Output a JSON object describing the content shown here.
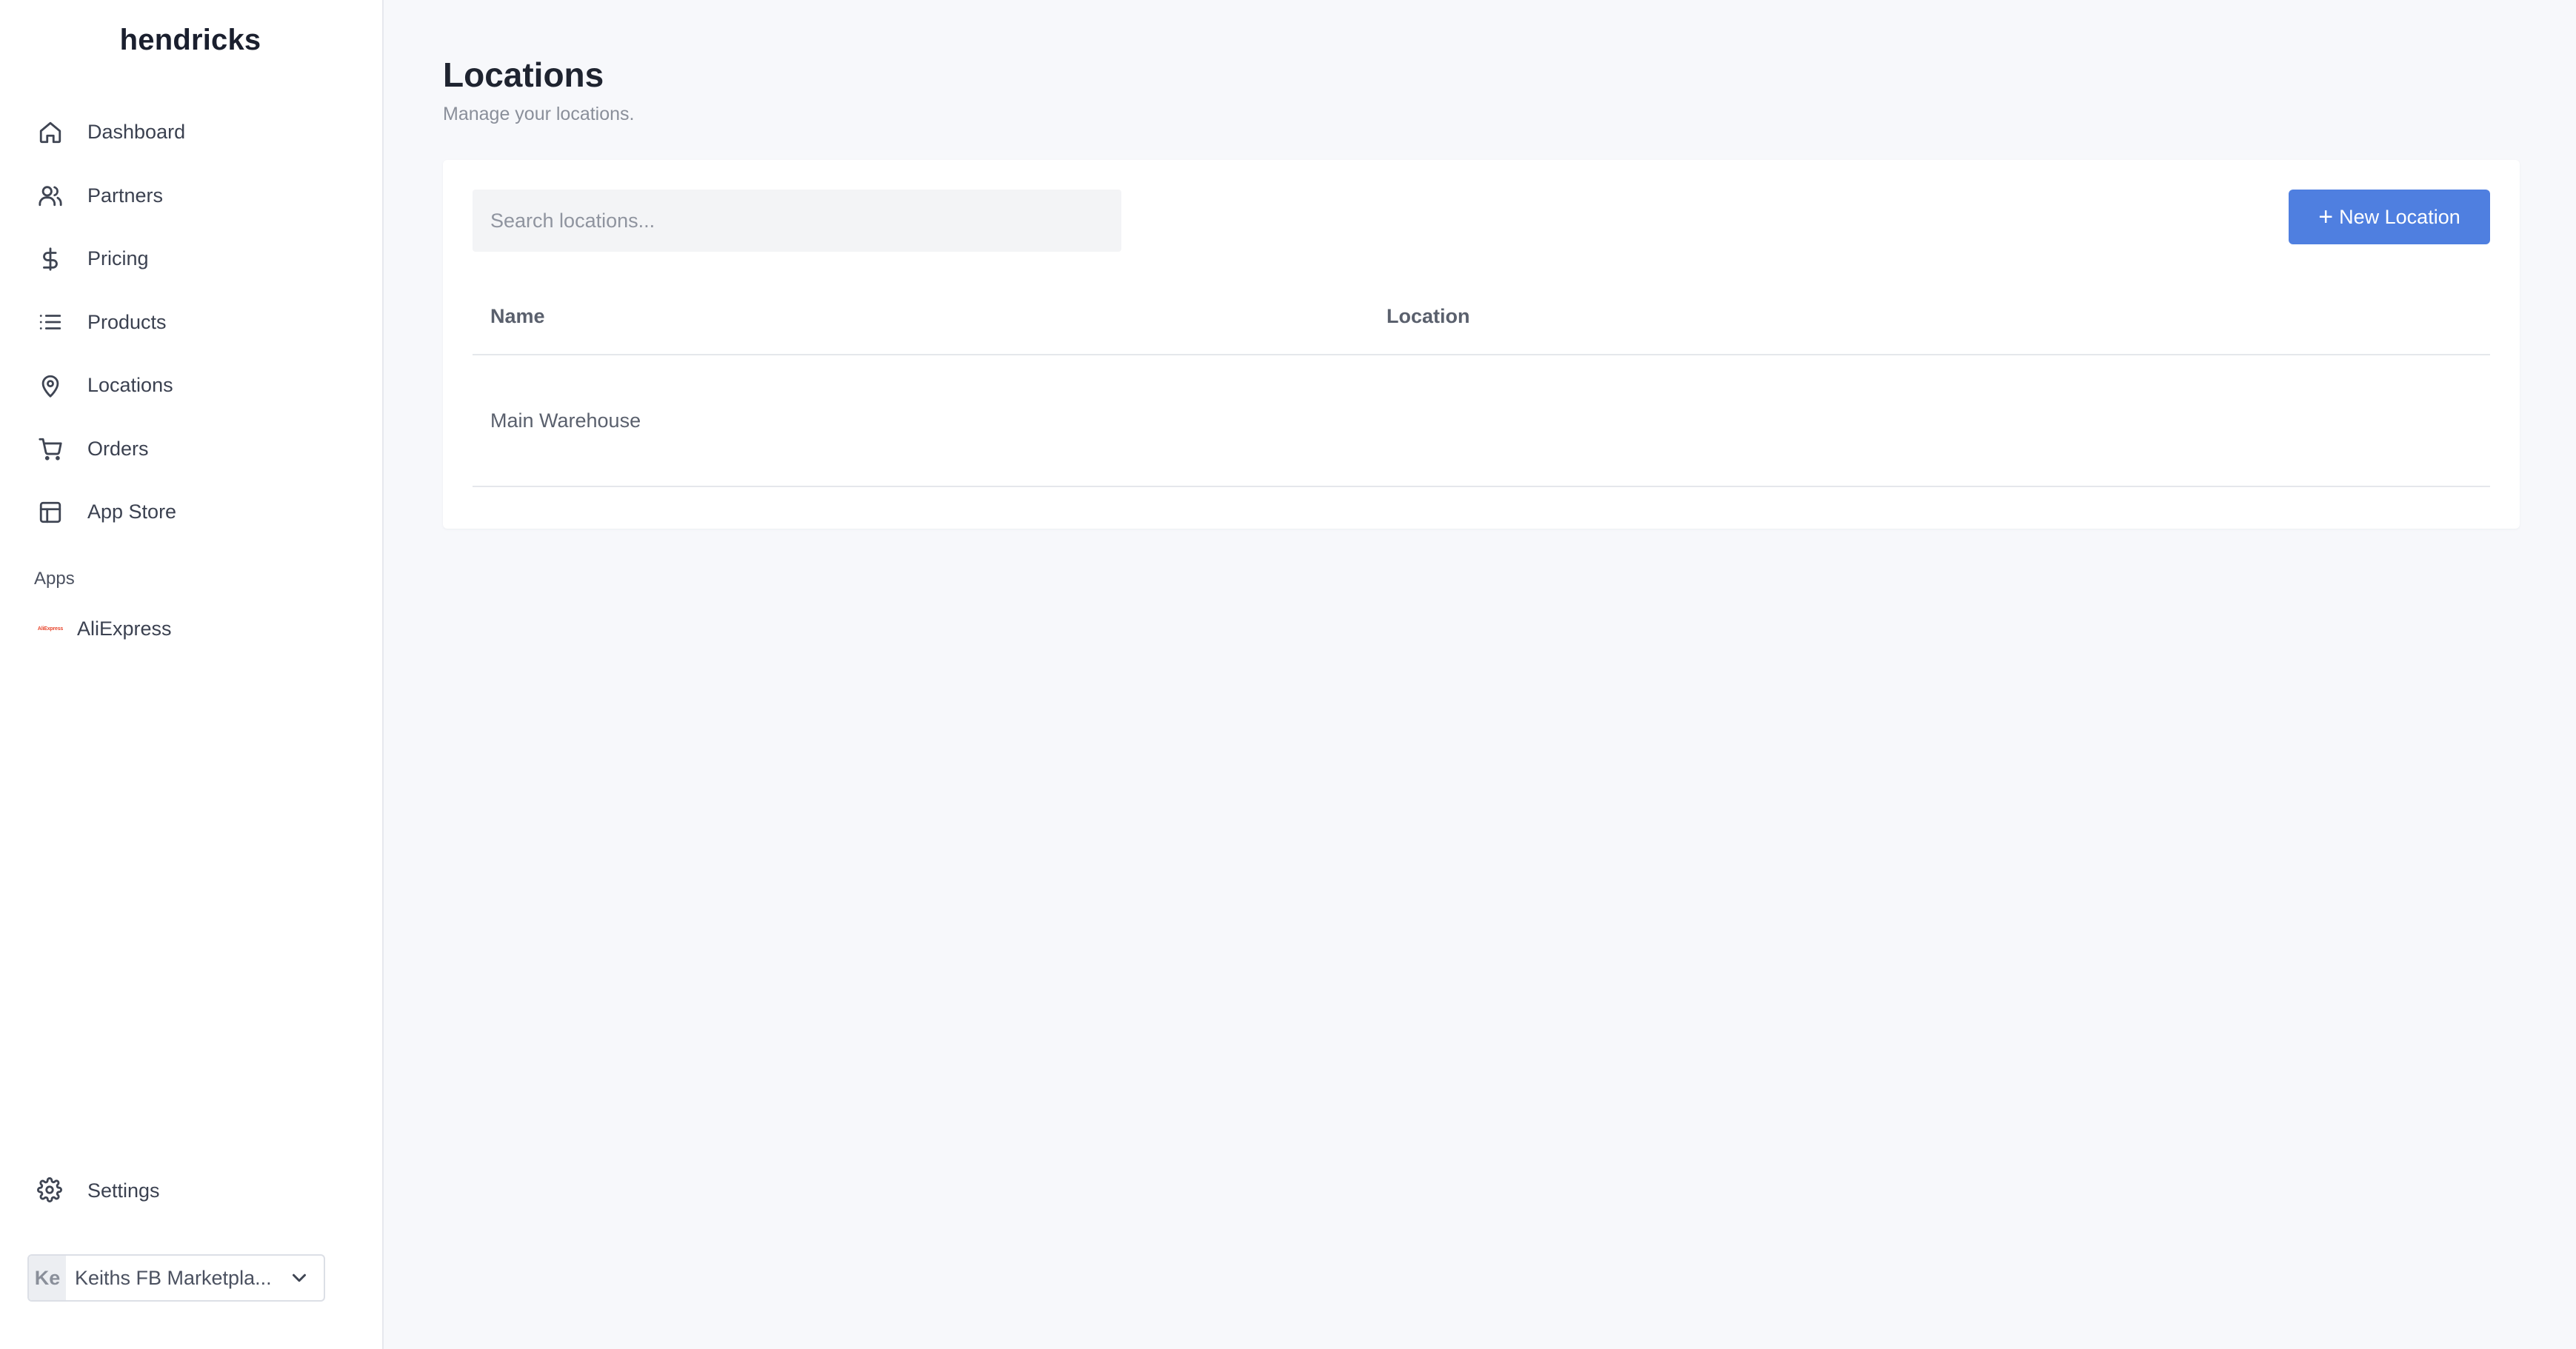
{
  "sidebar": {
    "brand": "hendricks",
    "nav": [
      {
        "label": "Dashboard",
        "icon": "home-icon"
      },
      {
        "label": "Partners",
        "icon": "users-icon"
      },
      {
        "label": "Pricing",
        "icon": "dollar-icon"
      },
      {
        "label": "Products",
        "icon": "list-icon"
      },
      {
        "label": "Locations",
        "icon": "map-pin-icon"
      },
      {
        "label": "Orders",
        "icon": "cart-icon"
      },
      {
        "label": "App Store",
        "icon": "layout-icon"
      }
    ],
    "apps_label": "Apps",
    "apps": [
      {
        "label": "AliExpress",
        "logo_text": "AliExpress",
        "icon": "aliexpress-logo",
        "logo_color": "#e8452c"
      }
    ],
    "settings_label": "Settings",
    "workspace": {
      "initials": "Ke",
      "name": "Keiths FB Marketpla..."
    }
  },
  "main": {
    "title": "Locations",
    "subtitle": "Manage your locations.",
    "search": {
      "placeholder": "Search locations...",
      "value": ""
    },
    "new_button_label": "New Location",
    "table": {
      "columns": [
        "Name",
        "Location"
      ],
      "rows": [
        {
          "name": "Main Warehouse",
          "location": ""
        }
      ]
    }
  },
  "colors": {
    "accent": "#4f7fe0",
    "background": "#f7f8fb",
    "sidebar_bg": "#ffffff"
  }
}
